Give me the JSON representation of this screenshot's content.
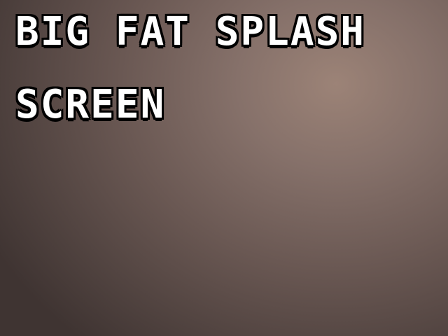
{
  "splash": {
    "title_line_1": "BIG FAT SPLASH",
    "title_line_2": "SCREEN"
  },
  "colors": {
    "text": "#ffffff",
    "outline": "#000000",
    "background_center": "#9c8377",
    "background_edge": "#3f3432"
  }
}
